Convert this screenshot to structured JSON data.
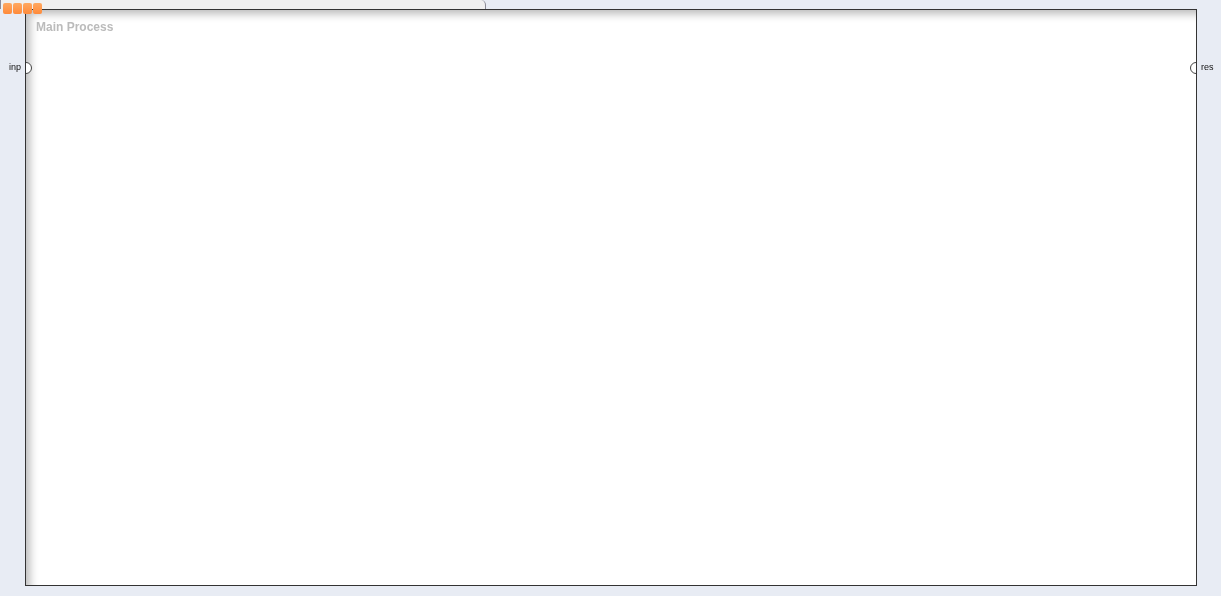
{
  "process": {
    "title": "Main Process",
    "ports": [
      {
        "label": "inp",
        "kind": "input"
      },
      {
        "label": "res",
        "kind": "output"
      }
    ]
  }
}
